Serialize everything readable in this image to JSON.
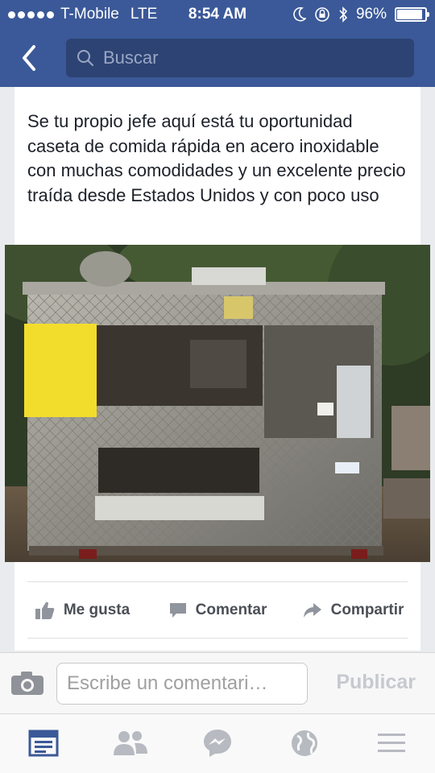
{
  "status_bar": {
    "carrier": "T-Mobile",
    "network": "LTE",
    "time": "8:54 AM",
    "battery_percent": "96%",
    "battery_level": 0.96,
    "icons": [
      "signal-dots-icon",
      "moon-icon",
      "rotation-lock-icon",
      "bluetooth-icon",
      "battery-icon"
    ]
  },
  "nav": {
    "back_icon": "chevron-left-icon",
    "search_placeholder": "Buscar"
  },
  "post": {
    "text": "Se tu propio jefe aquí está tu oportunidad caseta de comida rápida en acero inoxidable con muchas comodidades y un excelente precio traída desde Estados Unidos y con poco uso",
    "actions": [
      {
        "label": "Me gusta",
        "icon": "thumbs-up-icon"
      },
      {
        "label": "Comentar",
        "icon": "comment-icon"
      },
      {
        "label": "Compartir",
        "icon": "share-arrow-icon"
      }
    ]
  },
  "comment_bar": {
    "camera_icon": "camera-icon",
    "placeholder": "Escribe un comentari…",
    "publish_label": "Publicar"
  },
  "tab_bar": {
    "tabs": [
      "news-feed-icon",
      "friends-icon",
      "messenger-icon",
      "globe-icon",
      "menu-icon"
    ],
    "active_color": "#3b5998",
    "inactive_color": "#b7bac1"
  },
  "colors": {
    "brand": "#3b5998",
    "brand_dark": "#2d4373"
  }
}
